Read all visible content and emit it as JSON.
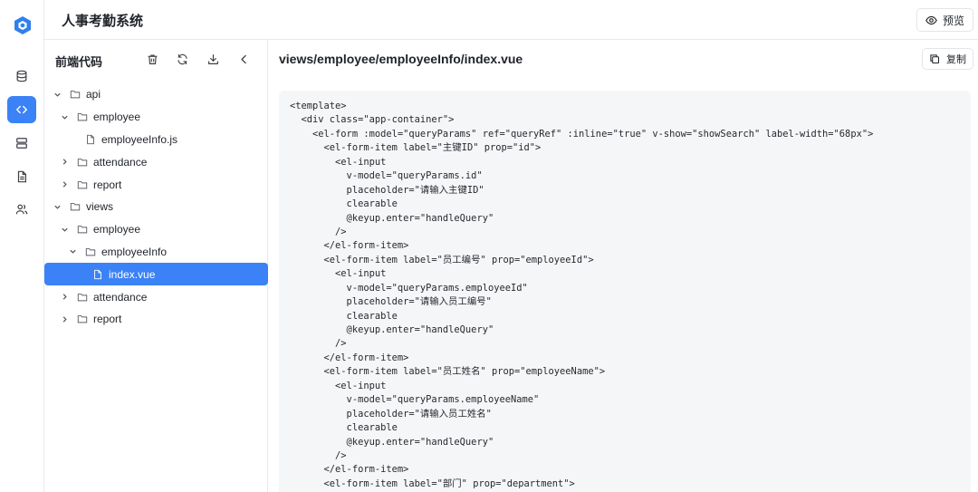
{
  "header": {
    "title": "人事考勤系统",
    "preview_label": "预览"
  },
  "rail": {
    "items": [
      {
        "icon": "database-icon",
        "active": false
      },
      {
        "icon": "code-icon",
        "active": true
      },
      {
        "icon": "server-icon",
        "active": false
      },
      {
        "icon": "document-icon",
        "active": false
      },
      {
        "icon": "users-icon",
        "active": false
      }
    ]
  },
  "sidebar": {
    "title": "前端代码",
    "tools": [
      "delete-icon",
      "refresh-icon",
      "download-icon",
      "collapse-icon"
    ],
    "tree": [
      {
        "label": "api",
        "type": "folder",
        "expanded": true,
        "level": 0
      },
      {
        "label": "employee",
        "type": "folder",
        "expanded": true,
        "level": 1
      },
      {
        "label": "employeeInfo.js",
        "type": "file",
        "level": 2
      },
      {
        "label": "attendance",
        "type": "folder",
        "expanded": false,
        "level": 1
      },
      {
        "label": "report",
        "type": "folder",
        "expanded": false,
        "level": 1
      },
      {
        "label": "views",
        "type": "folder",
        "expanded": true,
        "level": 0
      },
      {
        "label": "employee",
        "type": "folder",
        "expanded": true,
        "level": 1
      },
      {
        "label": "employeeInfo",
        "type": "folder",
        "expanded": true,
        "level": 2
      },
      {
        "label": "index.vue",
        "type": "file",
        "level": 3,
        "selected": true
      },
      {
        "label": "attendance",
        "type": "folder",
        "expanded": false,
        "level": 1
      },
      {
        "label": "report",
        "type": "folder",
        "expanded": false,
        "level": 1
      }
    ]
  },
  "main": {
    "file_path": "views/employee/employeeInfo/index.vue",
    "copy_label": "复制",
    "code_lines": [
      "<template>",
      "  <div class=\"app-container\">",
      "    <el-form :model=\"queryParams\" ref=\"queryRef\" :inline=\"true\" v-show=\"showSearch\" label-width=\"68px\">",
      "      <el-form-item label=\"主键ID\" prop=\"id\">",
      "        <el-input",
      "          v-model=\"queryParams.id\"",
      "          placeholder=\"请输入主键ID\"",
      "          clearable",
      "          @keyup.enter=\"handleQuery\"",
      "        />",
      "      </el-form-item>",
      "      <el-form-item label=\"员工编号\" prop=\"employeeId\">",
      "        <el-input",
      "          v-model=\"queryParams.employeeId\"",
      "          placeholder=\"请输入员工编号\"",
      "          clearable",
      "          @keyup.enter=\"handleQuery\"",
      "        />",
      "      </el-form-item>",
      "      <el-form-item label=\"员工姓名\" prop=\"employeeName\">",
      "        <el-input",
      "          v-model=\"queryParams.employeeName\"",
      "          placeholder=\"请输入员工姓名\"",
      "          clearable",
      "          @keyup.enter=\"handleQuery\"",
      "        />",
      "      </el-form-item>",
      "      <el-form-item label=\"部门\" prop=\"department\">"
    ]
  },
  "colors": {
    "accent": "#3b82f6",
    "code_bg": "#f5f6f7",
    "border": "#e8eaed"
  }
}
